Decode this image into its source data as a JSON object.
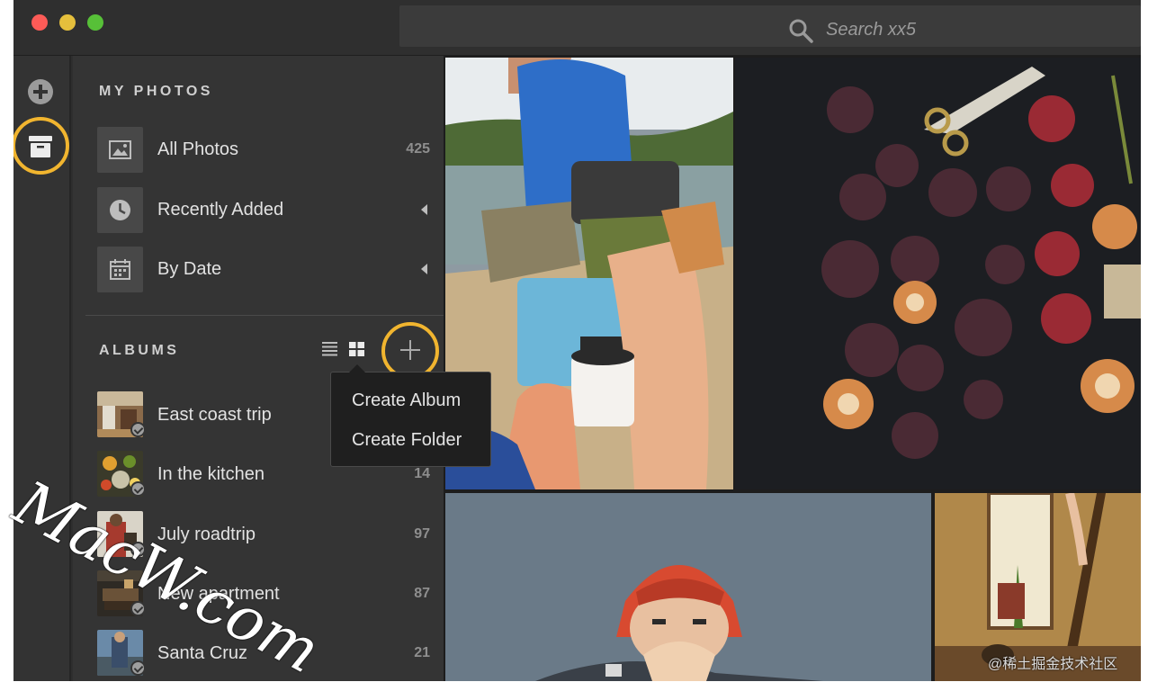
{
  "search": {
    "placeholder": "Search xx5"
  },
  "sidebar": {
    "my_photos_title": "MY PHOTOS",
    "nav": [
      {
        "label": "All Photos",
        "count": "425",
        "icon": "image-icon"
      },
      {
        "label": "Recently Added",
        "icon": "clock-icon"
      },
      {
        "label": "By Date",
        "icon": "calendar-icon"
      }
    ],
    "albums_title": "ALBUMS",
    "albums": [
      {
        "label": "East coast trip",
        "count": ""
      },
      {
        "label": "In the kitchen",
        "count": "14"
      },
      {
        "label": "July roadtrip",
        "count": "97"
      },
      {
        "label": "New apartment",
        "count": "87"
      },
      {
        "label": "Santa Cruz",
        "count": "21"
      }
    ]
  },
  "dropdown": {
    "items": [
      "Create Album",
      "Create Folder"
    ]
  },
  "overlay": {
    "watermark": "MacW.com",
    "credit": "@稀土掘金技术社区"
  },
  "colors": {
    "highlight_ring": "#f1b52f",
    "sidebar_bg": "#343434",
    "window_bg": "#2e2e2e"
  }
}
